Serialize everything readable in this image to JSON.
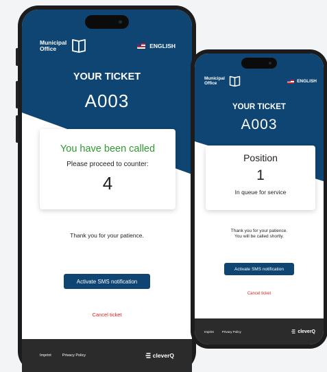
{
  "colors": {
    "brand_blue": "#0f4572",
    "called_green": "#2f9a2f",
    "cancel_red": "#e02020",
    "footer_dark": "#2b2b2b"
  },
  "phone_called": {
    "header": {
      "logo_text_line1": "Municipal",
      "logo_text_line2": "Office",
      "logo_icon": "book-icon",
      "language": "ENGLISH",
      "flag_icon": "us-flag-icon"
    },
    "ticket_title": "YOUR TICKET",
    "ticket_number": "A003",
    "card": {
      "status": "You have been called",
      "instruction": "Please proceed to counter:",
      "counter": "4"
    },
    "message": "Thank you for your patience.",
    "sms_button": "Activate SMS notification",
    "cancel_link": "Cancel ticket",
    "footer": {
      "imprint": "Imprint",
      "privacy": "Privacy Policy",
      "brand": "cleverQ",
      "brand_icon": "cleverq-logo-icon"
    }
  },
  "phone_queue": {
    "header": {
      "logo_text_line1": "Municipal",
      "logo_text_line2": "Office",
      "logo_icon": "book-icon",
      "language": "ENGLISH",
      "flag_icon": "us-flag-icon"
    },
    "ticket_title": "YOUR TICKET",
    "ticket_number": "A003",
    "card": {
      "heading": "Position",
      "position": "1",
      "subtext": "In queue for service"
    },
    "message_line1": "Thank you for your patience.",
    "message_line2": "You will be called shortly.",
    "sms_button": "Activate SMS notification",
    "cancel_link": "Cancel ticket",
    "footer": {
      "imprint": "Imprint",
      "privacy": "Privacy Policy",
      "brand": "cleverQ",
      "brand_icon": "cleverq-logo-icon"
    }
  }
}
